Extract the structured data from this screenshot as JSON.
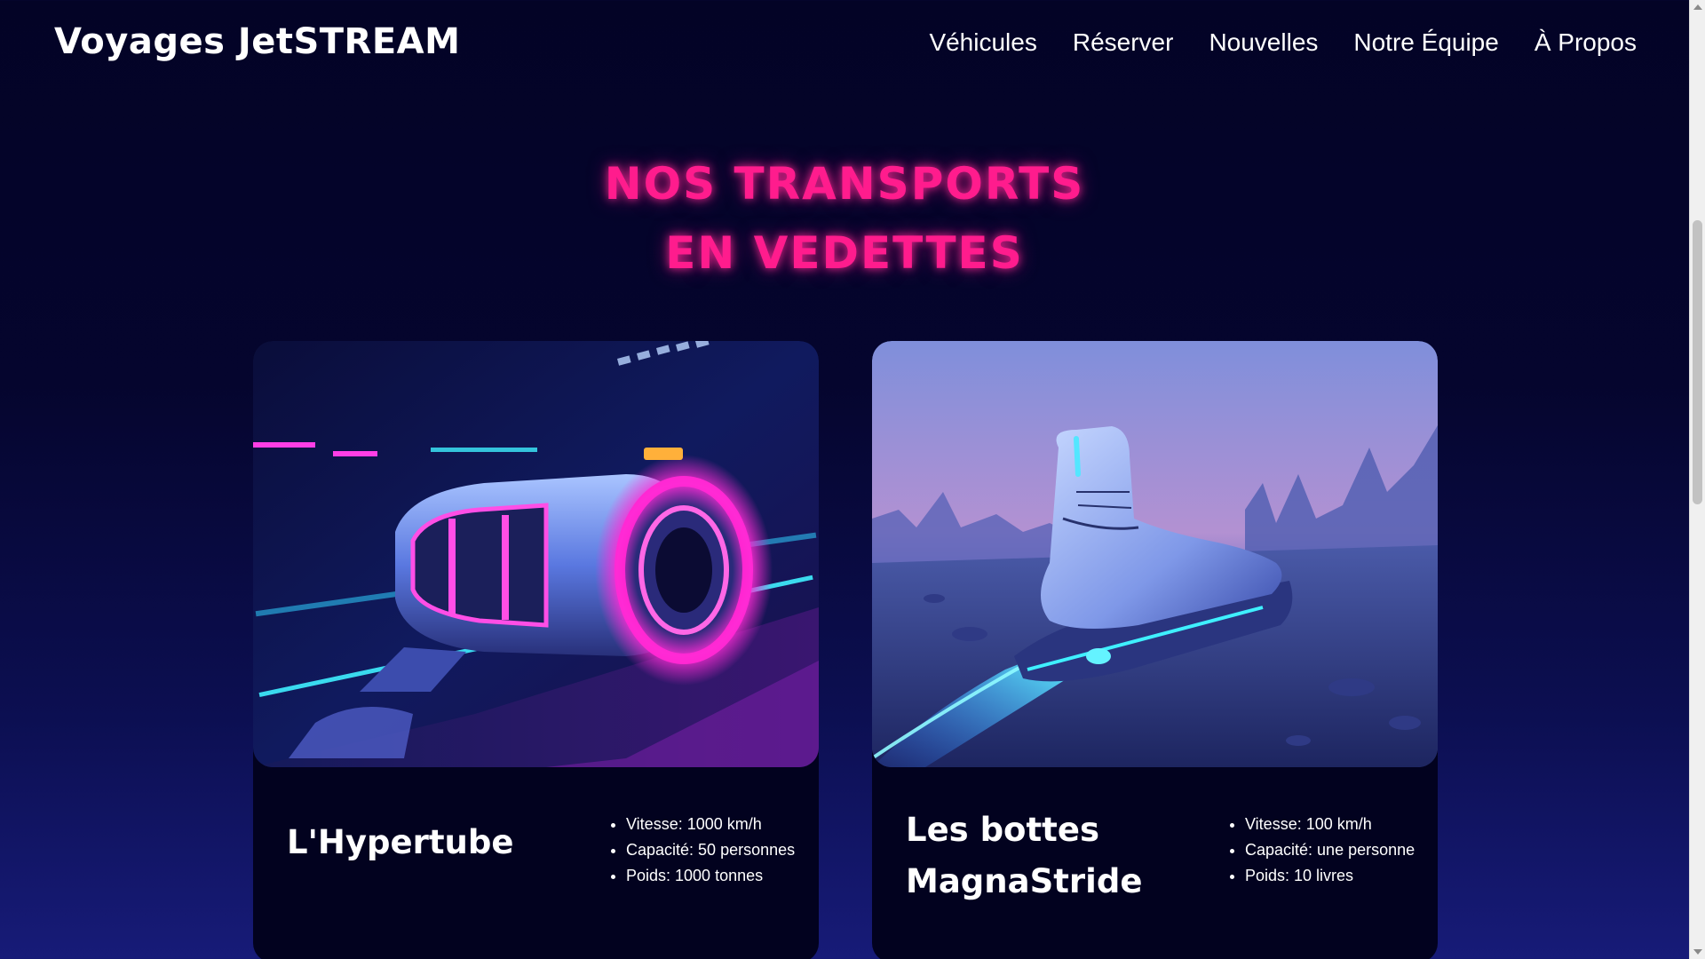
{
  "header": {
    "brand": "Voyages JetSTREAM",
    "nav": [
      "Véhicules",
      "Réserver",
      "Nouvelles",
      "Notre Équipe",
      "À Propos"
    ]
  },
  "section": {
    "title_line1": "NOS TRANSPORTS",
    "title_line2": "EN VEDETTES"
  },
  "cards": [
    {
      "name": "L'Hypertube",
      "image_icon": "hypertube-pod-illustration",
      "specs": [
        "Vitesse: 1000 km/h",
        "Capacité: 50 personnes",
        "Poids: 1000 tonnes"
      ]
    },
    {
      "name": "Les bottes MagnaStride",
      "image_icon": "hover-boot-illustration",
      "specs": [
        "Vitesse: 100 km/h",
        "Capacité: une personne",
        "Poids: 10 livres"
      ]
    }
  ],
  "colors": {
    "accent_pink": "#ff1c8d",
    "neon_cyan": "#3ff0ff",
    "background_dark": "#030326",
    "card_background": "#02021f"
  }
}
